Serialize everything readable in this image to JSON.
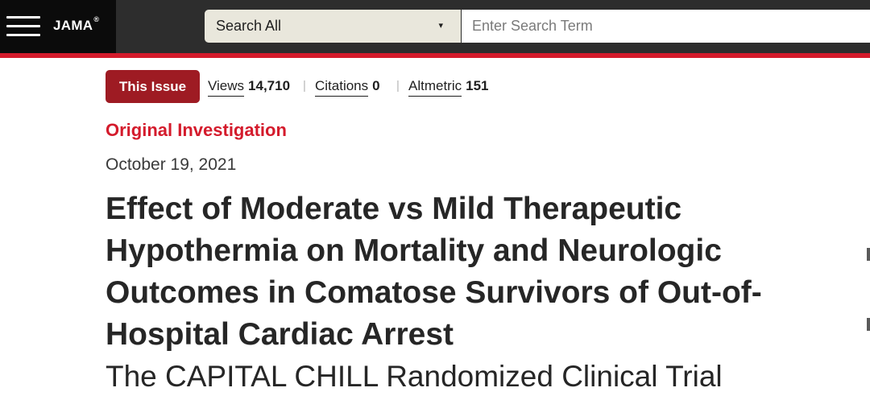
{
  "header": {
    "logo_text": "JAMA",
    "logo_mark": "®",
    "menu_icon": "hamburger-menu-icon",
    "search": {
      "scope_label": "Search All",
      "scope_icon": "caret-down-icon",
      "scope_arrow": "▾",
      "placeholder": "Enter Search Term"
    }
  },
  "metrics": {
    "issue_button": "This Issue",
    "separator": "|",
    "views_label": "Views",
    "views_value": "14,710",
    "citations_label": "Citations",
    "citations_value": "0",
    "altmetric_label": "Altmetric",
    "altmetric_value": "151"
  },
  "article": {
    "type": "Original Investigation",
    "date": "October 19, 2021",
    "title": "Effect of Moderate vs Mild Therapeutic Hypothermia on Mortality and Neurologic Outcomes in Comatose Survivors of Out-of-Hospital Cardiac Arrest",
    "subtitle": "The CAPITAL CHILL Randomized Clinical Trial"
  },
  "colors": {
    "header_bg": "#2d2d2d",
    "brand_bg": "#0b0b0b",
    "accent_red": "#d41b2c",
    "issue_button_bg": "#9e1b23",
    "search_scope_bg": "#e9e7dc"
  }
}
